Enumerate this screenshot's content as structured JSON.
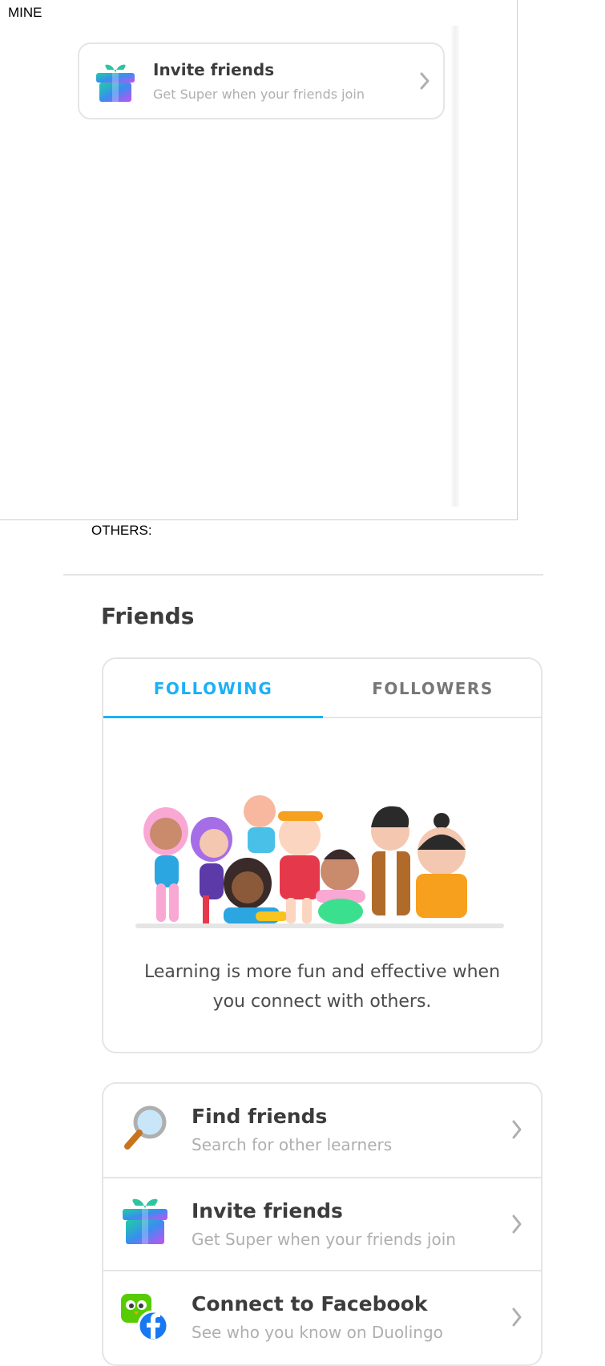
{
  "mine": {
    "caption": "MINE",
    "invite": {
      "title": "Invite friends",
      "subtitle": "Get Super when your friends join"
    }
  },
  "others": {
    "caption": "OTHERS:",
    "heading": "Friends",
    "tabs": [
      {
        "label": "FOLLOWING",
        "active": true
      },
      {
        "label": "FOLLOWERS",
        "active": false
      }
    ],
    "empty_message_line1": "Learning is more fun and effective when",
    "empty_message_line2": "you connect with others.",
    "actions": [
      {
        "icon": "magnifier-icon",
        "title": "Find friends",
        "subtitle": "Search for other learners"
      },
      {
        "icon": "gift-icon",
        "title": "Invite friends",
        "subtitle": "Get Super when your friends join"
      },
      {
        "icon": "facebook-duo-icon",
        "title": "Connect to Facebook",
        "subtitle": "See who you know on Duolingo"
      }
    ]
  },
  "colors": {
    "accent": "#1cb0f6",
    "border": "#e5e5e5",
    "muted": "#afafaf",
    "text": "#3c3c3c"
  }
}
